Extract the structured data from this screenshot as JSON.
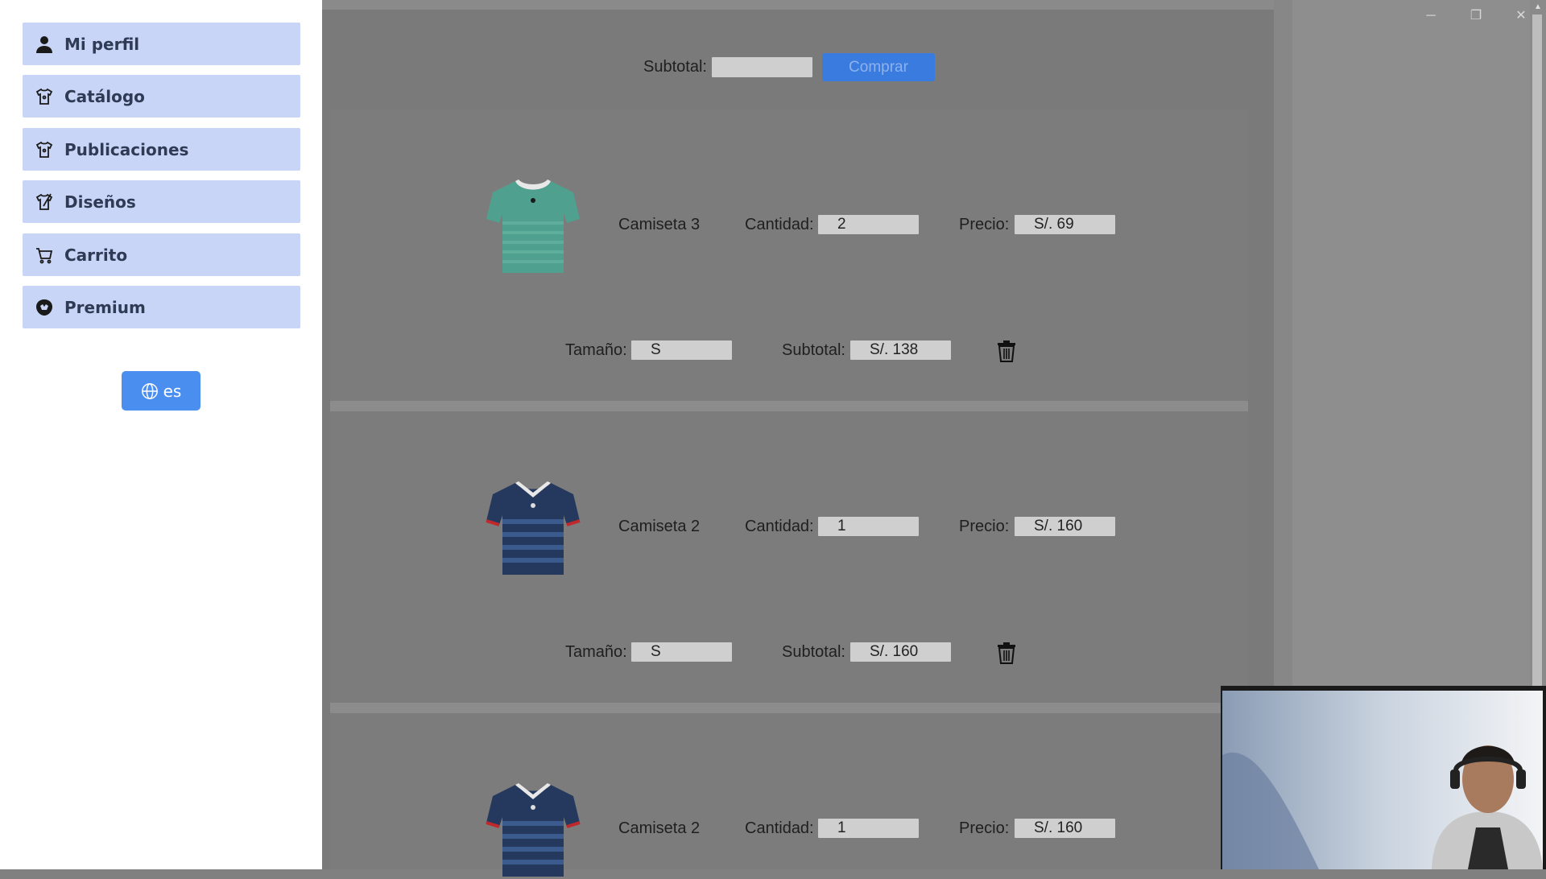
{
  "sidebar": {
    "items": [
      {
        "label": "Mi perfil",
        "icon": "user-icon"
      },
      {
        "label": "Catálogo",
        "icon": "shirt-tag-icon"
      },
      {
        "label": "Publicaciones",
        "icon": "shirt-tag-icon"
      },
      {
        "label": "Diseños",
        "icon": "shirt-brush-icon"
      },
      {
        "label": "Carrito",
        "icon": "cart-icon"
      },
      {
        "label": "Premium",
        "icon": "premium-badge-icon"
      }
    ],
    "language": {
      "label": "es",
      "icon": "globe-icon"
    }
  },
  "header": {
    "subtotal_label": "Subtotal:",
    "subtotal_value": "",
    "buy_label": "Comprar"
  },
  "cart": {
    "labels": {
      "quantity": "Cantidad:",
      "price": "Precio:",
      "size": "Tamaño:",
      "subtotal": "Subtotal:"
    },
    "items": [
      {
        "name": "Camiseta 3",
        "quantity": "2",
        "price": "S/. 69",
        "size": "S",
        "subtotal": "S/. 138",
        "color": "#4fa08f"
      },
      {
        "name": "Camiseta 2",
        "quantity": "1",
        "price": "S/. 160",
        "size": "S",
        "subtotal": "S/. 160",
        "color": "#25385e"
      },
      {
        "name": "Camiseta 2",
        "quantity": "1",
        "price": "S/. 160",
        "color": "#25385e"
      }
    ]
  },
  "colors": {
    "nav_bg": "#c9d5f7",
    "accent": "#3a7be0",
    "lang_button": "#4a8ff0"
  }
}
